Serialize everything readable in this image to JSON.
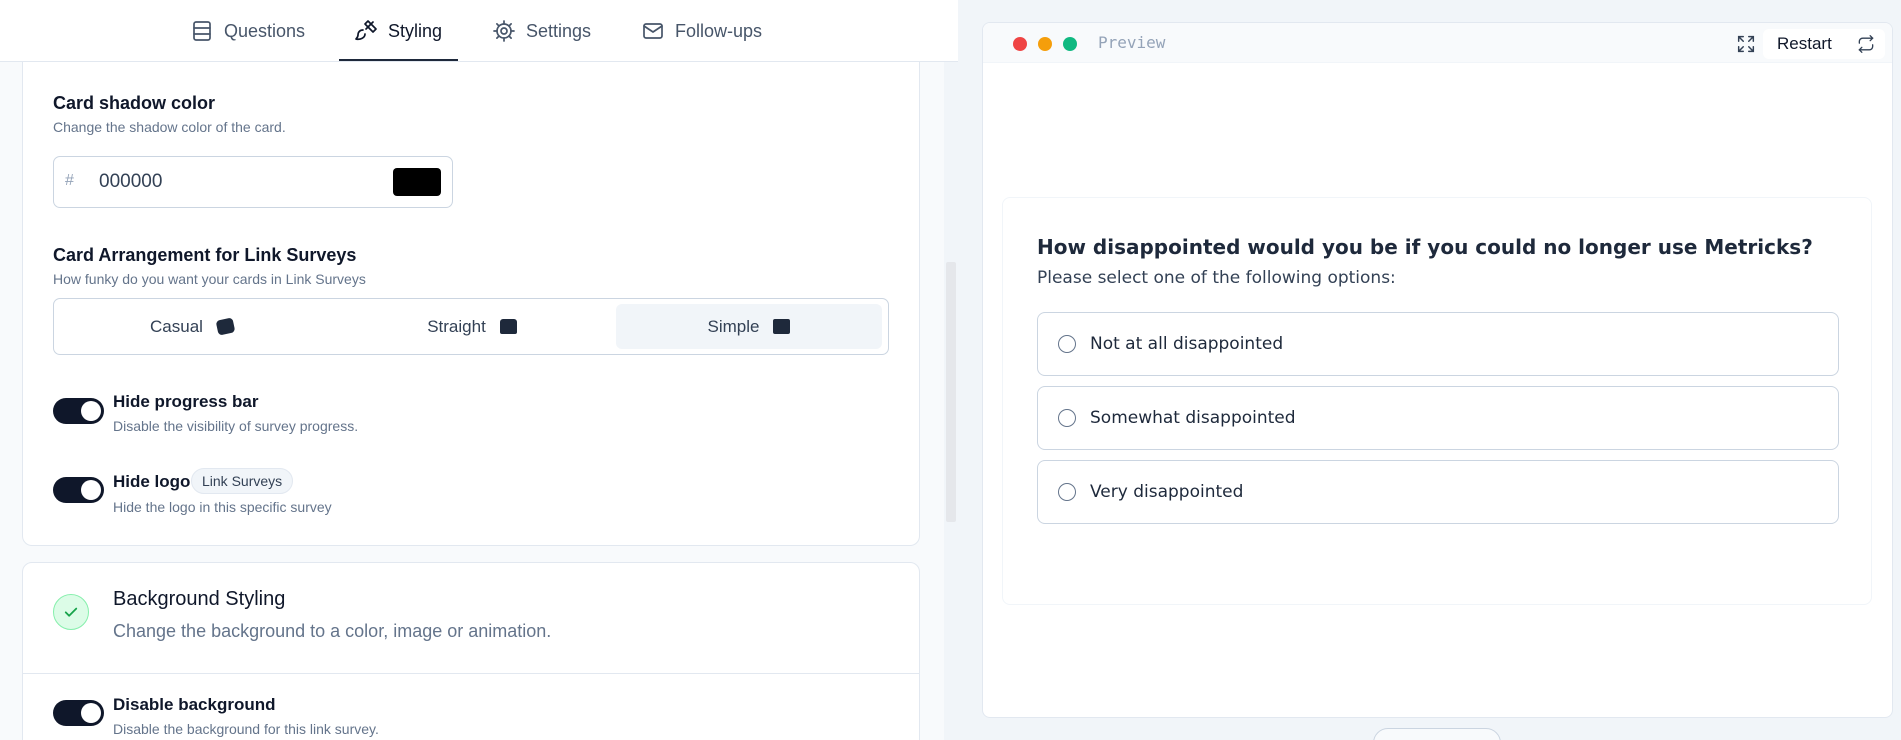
{
  "nav": {
    "tabs": [
      {
        "label": "Questions",
        "icon": "questions-icon"
      },
      {
        "label": "Styling",
        "icon": "paintbrush-icon",
        "active": true
      },
      {
        "label": "Settings",
        "icon": "gear-icon"
      },
      {
        "label": "Follow-ups",
        "icon": "mail-icon"
      }
    ]
  },
  "card_shadow": {
    "title": "Card shadow color",
    "description": "Change the shadow color of the card.",
    "hash": "#",
    "value": "000000",
    "swatch_color": "#000000"
  },
  "card_arrangement": {
    "title": "Card Arrangement for Link Surveys",
    "description": "How funky do you want your cards in Link Surveys",
    "options": [
      "Casual",
      "Straight",
      "Simple"
    ],
    "selected": "Simple"
  },
  "hide_progress": {
    "title": "Hide progress bar",
    "description": "Disable the visibility of survey progress.",
    "enabled": true
  },
  "hide_logo": {
    "title": "Hide logo",
    "badge": "Link Surveys",
    "description": "Hide the logo in this specific survey",
    "enabled": true
  },
  "background_styling": {
    "title": "Background Styling",
    "description": "Change the background to a color, image or animation."
  },
  "disable_background": {
    "title": "Disable background",
    "description": "Disable the background for this link survey.",
    "enabled": true
  },
  "preview": {
    "label": "Preview",
    "restart_label": "Restart",
    "question": "How disappointed would you be if you could no longer use Metricks?",
    "subheader": "Please select one of the following options:",
    "options": [
      "Not at all disappointed",
      "Somewhat disappointed",
      "Very disappointed"
    ]
  },
  "colors": {
    "accent": "#0f172a",
    "success": "#16a34a",
    "dot_red": "#ef4444",
    "dot_yellow": "#f59e0b",
    "dot_green": "#10b981"
  }
}
